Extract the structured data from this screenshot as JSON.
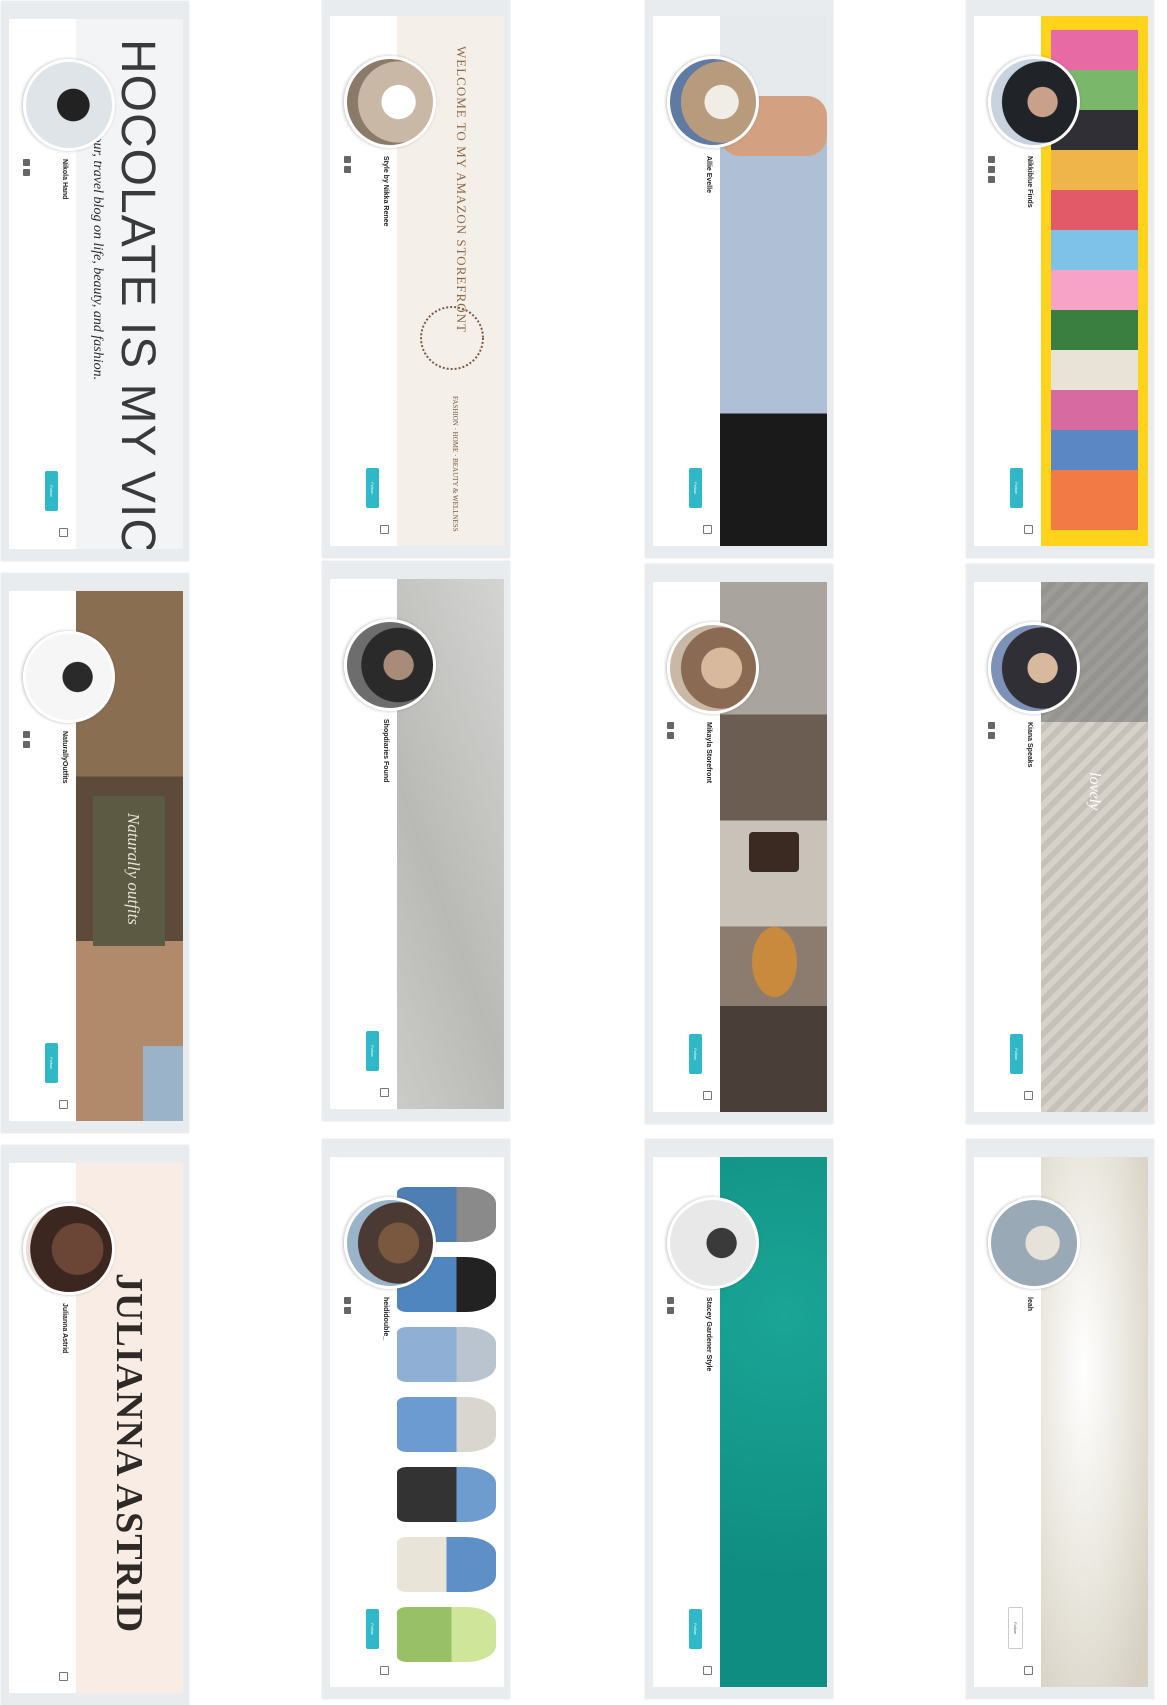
{
  "cards": [
    {
      "id": "julianna",
      "name": "Julianna Astrid",
      "headline": "JULIANNA ASTRID",
      "follow_label": "",
      "colors": {
        "banner": "#f9ece4",
        "avatar": "#5a3b2e"
      }
    },
    {
      "id": "naturally",
      "name": "NaturallyOutfits",
      "headline": "Naturally outfits",
      "follow_label": "Follow",
      "colors": {
        "banner": "#8a6e52",
        "avatar": "#f4f4f4"
      }
    },
    {
      "id": "chocolate",
      "name": "Nikola Hand",
      "headline": "HOCOLATE IS MY VIC",
      "subheadline": "a glamour, travel blog on life, beauty, and fashion.",
      "follow_label": "Follow",
      "colors": {
        "banner": "#f2f4f5",
        "avatar": "#dfe4e8"
      }
    },
    {
      "id": "denim",
      "name": "heididouble_",
      "follow_label": "Follow",
      "colors": {
        "banner": "#ffffff",
        "avatar": "#6b4c3a"
      }
    },
    {
      "id": "grey",
      "name": "Shopdiaries Found",
      "follow_label": "Follow",
      "colors": {
        "banner": "#c9c9c7",
        "avatar": "#3a3a3a"
      }
    },
    {
      "id": "storefront",
      "name": "Style by Nikka Renee",
      "headline": "WELCOME TO MY AMAZON STOREFRONT",
      "tags": "FASHION · HOME · BEAUTY & WELLNESS",
      "follow_label": "Follow",
      "colors": {
        "banner": "#f4efe9",
        "avatar": "#c9b8a6"
      }
    },
    {
      "id": "teal",
      "name": "Stacey Gardener Style",
      "follow_label": "Follow",
      "colors": {
        "banner": "#129688",
        "avatar": "#d9d9d9"
      }
    },
    {
      "id": "cafe",
      "name": "Mikayla Storefront",
      "follow_label": "Follow",
      "colors": {
        "banner": "#8c7b6f",
        "avatar": "#c4a48d"
      }
    },
    {
      "id": "blue-skirt",
      "name": "Allie Evelle",
      "follow_label": "Follow",
      "colors": {
        "banner": "#e9ecef",
        "avatar": "#b89a7c"
      }
    },
    {
      "id": "satin",
      "name": "leah",
      "follow_label": "Follow",
      "colors": {
        "banner": "#efede6",
        "avatar": "#9aa9b6"
      }
    },
    {
      "id": "knit",
      "name": "Kiana Speaks",
      "headline": "lovely",
      "follow_label": "Follow",
      "colors": {
        "banner": "#cfcbc3",
        "avatar": "#2f2f35"
      }
    },
    {
      "id": "collage",
      "name": "Nikkiblue Finds",
      "follow_label": "Follow",
      "colors": {
        "banner": "#ffd21c",
        "avatar": "#202428"
      }
    }
  ]
}
